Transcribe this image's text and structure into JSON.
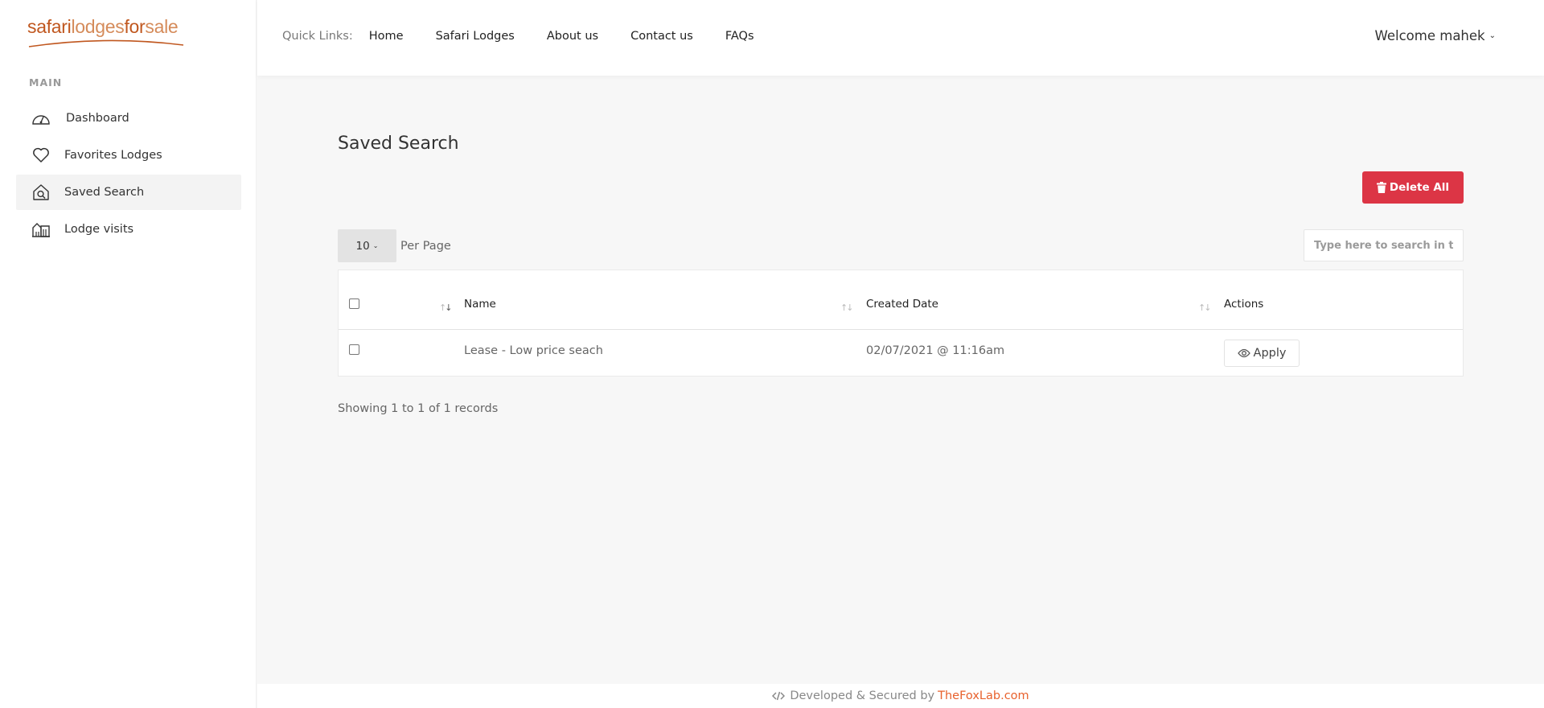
{
  "brand": {
    "logo_a": "safari",
    "logo_b": "lodges",
    "logo_c": "for",
    "logo_d": "sale",
    "accent_color": "#c0571f"
  },
  "sidebar": {
    "heading": "MAIN",
    "items": [
      {
        "label": "Dashboard",
        "icon": "dashboard-gauge-icon",
        "active": false
      },
      {
        "label": "Favorites Lodges",
        "icon": "heart-icon",
        "active": false
      },
      {
        "label": "Saved Search",
        "icon": "home-search-icon",
        "active": true
      },
      {
        "label": "Lodge visits",
        "icon": "buildings-icon",
        "active": false
      }
    ]
  },
  "header": {
    "quick_links_label": "Quick Links:",
    "links": [
      "Home",
      "Safari Lodges",
      "About us",
      "Contact us",
      "FAQs"
    ],
    "welcome": "Welcome mahek"
  },
  "main": {
    "title": "Saved Search",
    "delete_all_label": "Delete All",
    "delete_color": "#dc3545",
    "per_page_value": "10",
    "per_page_label": "Per Page",
    "search_placeholder": "Type here to search in table",
    "table": {
      "columns": [
        "Name",
        "Created Date",
        "Actions"
      ],
      "rows": [
        {
          "name": "Lease - Low price seach",
          "created": "02/07/2021 @ 11:16am",
          "action": "Apply"
        }
      ]
    },
    "records_text": "Showing 1 to 1 of 1 records"
  },
  "footer": {
    "text": "Developed & Secured by",
    "brand": "TheFoxLab.com",
    "brand_color": "#e8612c"
  }
}
